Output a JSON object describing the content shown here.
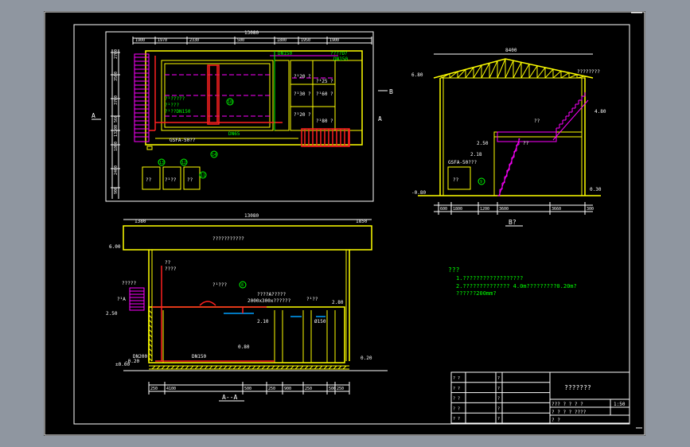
{
  "colors": {
    "background": "#8f96a0",
    "sheet": "#000000",
    "frame": "#ffffff",
    "concrete": "#ffff00",
    "stairs": "#ff00ff",
    "pipe": "#ff2020",
    "annotation": "#00ff00",
    "dimension": "#ffffff",
    "water": "#00a0ff"
  },
  "plan": {
    "overall_width": "13080",
    "top_dims": [
      "1900",
      "1970",
      "2330",
      "500",
      "1800",
      "1950",
      "1900"
    ],
    "labels": {
      "dn150_a": "DN150",
      "dn150_b": "DN150",
      "dn150_c": "DN150",
      "dn150_d": "DN150",
      "dn65": "DN65",
      "gsfa": "GSFA-50??",
      "pool_top": "????D?",
      "pool_a": "?¹?????",
      "pool_b": "?¹???",
      "pool_c": "?¹??DN150",
      "room1": "?¹20 ?",
      "room2": "?¹25 ?",
      "room3": "?¹30 ?",
      "room4": "?¹60 ?",
      "room5": "?¹20 ?",
      "room6": "?¹80 ?",
      "box1": "??",
      "box2": "?¹??",
      "box3": "??",
      "side_a1": "A",
      "side_a2": "A",
      "side_b": "B"
    },
    "callouts": [
      "13",
      "12",
      "11",
      "10",
      "14"
    ],
    "side_dims": [
      "2700",
      "3500",
      "3700",
      "560",
      "13200",
      "1800",
      "2400",
      "900"
    ]
  },
  "section_b": {
    "title": "B?",
    "top_dim": "8400",
    "labels": {
      "elev_top_left": "6.80",
      "elev_right": "4.80",
      "elev_mid": "2.50",
      "elev_mid2": "2.18",
      "elev_bottom_left": "-0.80",
      "elev_bottom_right": "0.30",
      "stair_label": "??",
      "stair_label2": "??",
      "roof_note": "????????",
      "gsfa": "GSFA-50???",
      "box": "??",
      "callout": "9"
    },
    "bottom_dims": [
      "600",
      "1800",
      "1200",
      "3600",
      "3660",
      "300"
    ]
  },
  "section_a": {
    "title": "A--A",
    "top_dim": "13080",
    "left_dim": "1380",
    "right_dim": "1850",
    "roof_label": "???????????",
    "labels": {
      "elev_600": "6.00",
      "elev_250": "2.50",
      "elev_000": "±0.00",
      "elev_top": "2.80",
      "elev_210": "2.10",
      "elev_080": "0.80",
      "elev_020": "0.20",
      "elev_n020": "-0.20",
      "pipe_note": "?????",
      "pipe_note2": "??",
      "pipe_note3": "????",
      "stair_note": "?¹???",
      "dn150": "DN150",
      "dn200": "DN200",
      "mid_note": "????A?????",
      "mid_note2": "2000x300x??????",
      "pool1": "?¹??",
      "pool2": "Ø150",
      "stair_a": "?¹A",
      "callout": "8"
    },
    "bottom_dims": [
      "250",
      "4100",
      "500",
      "250",
      "900",
      "250",
      "500",
      "250"
    ]
  },
  "notes": {
    "heading": "???",
    "line1": "1.??????????????????",
    "line2": "2.?????????????? 4.0m?????????0.20m?",
    "line3": "  ??????200mm?"
  },
  "title_block": {
    "title": "???????",
    "row_a": "??? ?  ?  ?  ?",
    "scale": "1:50",
    "row_b": "? ? ?  ?  ????",
    "row_c": "? ?",
    "left_rows": [
      "? ?",
      "? ?",
      "? ?",
      "? ?",
      "? ?"
    ],
    "left_cols": [
      "?",
      "?",
      "?",
      "?",
      "?"
    ]
  }
}
